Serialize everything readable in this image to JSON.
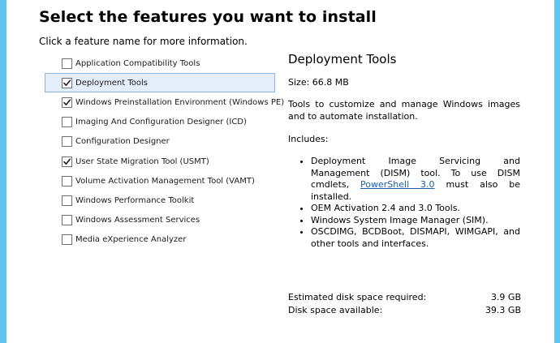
{
  "header": {
    "title": "Select the features you want to install",
    "subtitle": "Click a feature name for more information."
  },
  "features": [
    {
      "label": "Application Compatibility Tools",
      "checked": false,
      "selected": false
    },
    {
      "label": "Deployment Tools",
      "checked": true,
      "selected": true
    },
    {
      "label": "Windows Preinstallation Environment (Windows PE)",
      "checked": true,
      "selected": false
    },
    {
      "label": "Imaging And Configuration Designer (ICD)",
      "checked": false,
      "selected": false
    },
    {
      "label": "Configuration Designer",
      "checked": false,
      "selected": false
    },
    {
      "label": "User State Migration Tool (USMT)",
      "checked": true,
      "selected": false
    },
    {
      "label": "Volume Activation Management Tool (VAMT)",
      "checked": false,
      "selected": false
    },
    {
      "label": "Windows Performance Toolkit",
      "checked": false,
      "selected": false
    },
    {
      "label": "Windows Assessment Services",
      "checked": false,
      "selected": false
    },
    {
      "label": "Media eXperience Analyzer",
      "checked": false,
      "selected": false
    }
  ],
  "details": {
    "title": "Deployment Tools",
    "size": "Size: 66.8 MB",
    "description": "Tools to customize and manage Windows images and to automate installation.",
    "includes_label": "Includes:",
    "bullet1_text": "Deployment Image Servicing and Management (DISM) tool. To use DISM cmdlets,",
    "bullet1_link": "PowerShell 3.0",
    "bullet1_after": "must also be installed.",
    "bullet2": "OEM Activation 2.4 and 3.0 Tools.",
    "bullet3": "Windows System Image Manager (SIM).",
    "bullet4": "OSCDIMG, BCDBoot, DISMAPI, WIMGAPI, and other tools and interfaces."
  },
  "disk": {
    "required_label": "Estimated disk space required:",
    "required_value": "3.9 GB",
    "available_label": "Disk space available:",
    "available_value": "39.3 GB"
  },
  "colors": {
    "window_edge": "#5fc5f0",
    "selection_bg": "#e4eefb",
    "selection_border": "#8db1e2",
    "link": "#1a5fb4"
  }
}
